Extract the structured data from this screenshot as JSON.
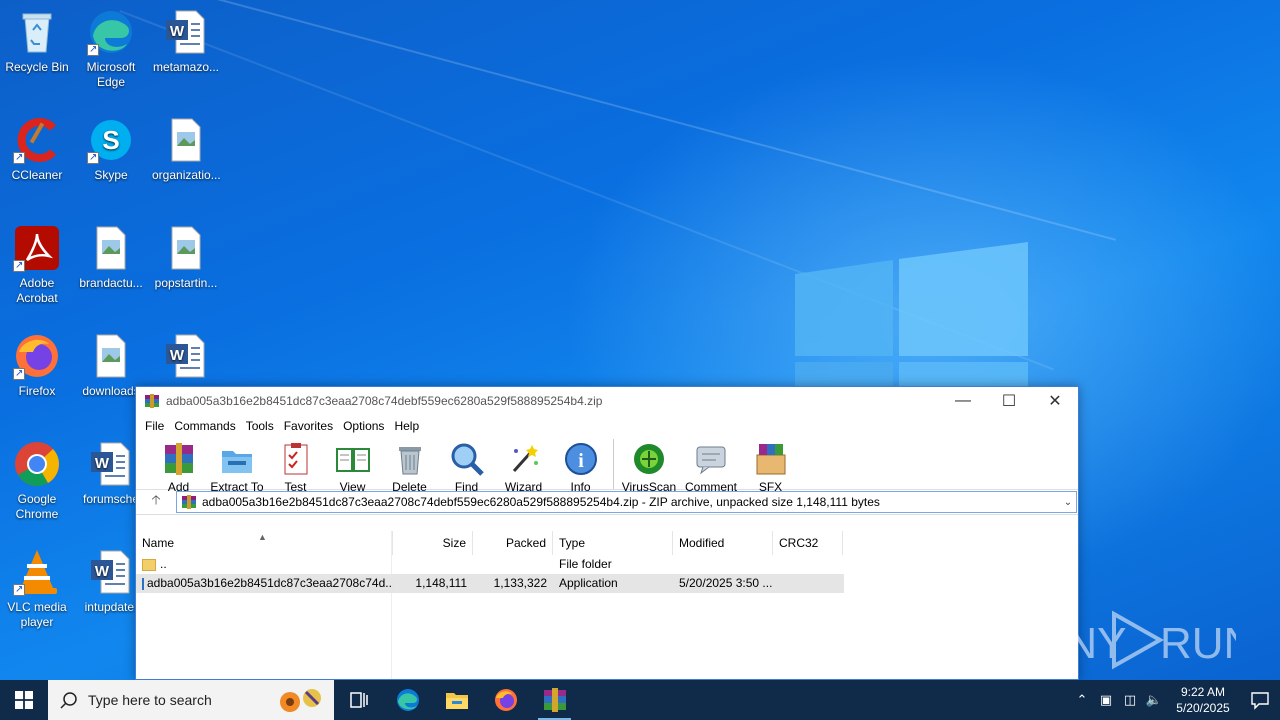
{
  "desktop": {
    "icons": [
      {
        "label": "Recycle Bin",
        "icon": "recycle-bin-icon"
      },
      {
        "label": "Microsoft Edge",
        "icon": "edge-icon"
      },
      {
        "label": "metamazo...",
        "icon": "word-doc-icon"
      },
      {
        "label": "CCleaner",
        "icon": "ccleaner-icon"
      },
      {
        "label": "Skype",
        "icon": "skype-icon"
      },
      {
        "label": "organizatio...",
        "icon": "image-file-icon"
      },
      {
        "label": "Adobe Acrobat",
        "icon": "acrobat-icon"
      },
      {
        "label": "brandactu...",
        "icon": "image-file-icon"
      },
      {
        "label": "popstartin...",
        "icon": "image-file-icon"
      },
      {
        "label": "Firefox",
        "icon": "firefox-icon"
      },
      {
        "label": "downloads",
        "icon": "image-file-icon"
      },
      {
        "label": "",
        "icon": "word-doc-icon"
      },
      {
        "label": "Google Chrome",
        "icon": "chrome-icon"
      },
      {
        "label": "forumsche",
        "icon": "word-doc-icon"
      },
      {
        "label": "VLC media player",
        "icon": "vlc-icon"
      },
      {
        "label": "intupdate.",
        "icon": "word-doc-icon"
      }
    ]
  },
  "winrar": {
    "title": "adba005a3b16e2b8451dc87c3eaa2708c74debf559ec6280a529f588895254b4.zip",
    "menu": [
      "File",
      "Commands",
      "Tools",
      "Favorites",
      "Options",
      "Help"
    ],
    "toolbar": [
      "Add",
      "Extract To",
      "Test",
      "View",
      "Delete",
      "Find",
      "Wizard",
      "Info",
      "VirusScan",
      "Comment",
      "SFX"
    ],
    "address": "adba005a3b16e2b8451dc87c3eaa2708c74debf559ec6280a529f588895254b4.zip - ZIP archive, unpacked size 1,148,111 bytes",
    "columns": [
      "Name",
      "Size",
      "Packed",
      "Type",
      "Modified",
      "CRC32"
    ],
    "rows": [
      {
        "name": "..",
        "size": "",
        "packed": "",
        "type": "File folder",
        "modified": "",
        "crc": ""
      },
      {
        "name": "adba005a3b16e2b8451dc87c3eaa2708c74d...",
        "size": "1,148,111",
        "packed": "1,133,322",
        "type": "Application",
        "modified": "5/20/2025 3:50 ...",
        "crc": ""
      }
    ]
  },
  "taskbar": {
    "search_placeholder": "Type here to search",
    "time": "9:22 AM",
    "date": "5/20/2025"
  },
  "watermark": "ANY RUN"
}
